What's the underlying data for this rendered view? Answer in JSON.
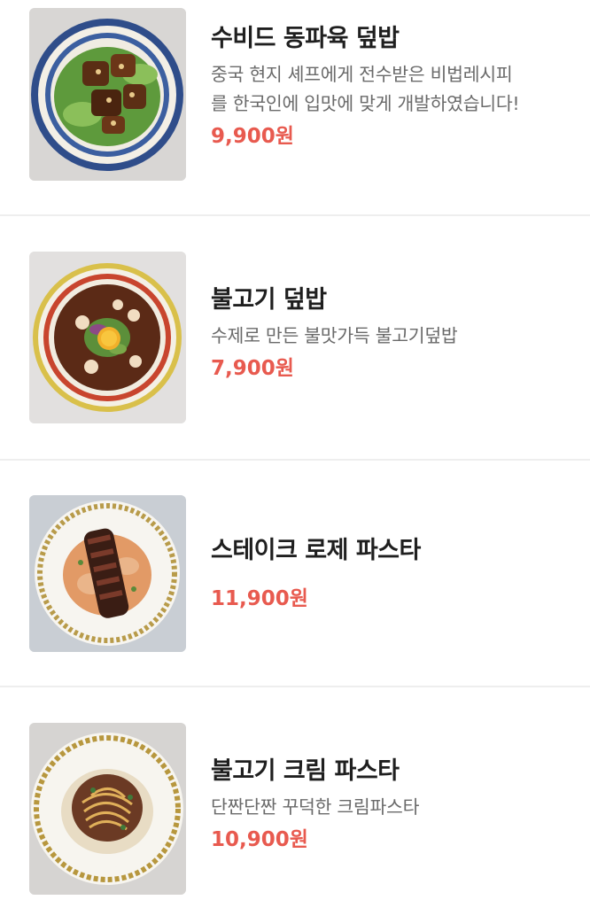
{
  "menu": {
    "items": [
      {
        "name": "수비드 동파육 덮밥",
        "description": "중국 현지 셰프에게 전수받은 비법레시피를 한국인에 입맛에 맞게 개발하였습니다!",
        "description_line1": "중국 현지 셰프에게 전수받은 비법레시피",
        "description_line2": "를 한국인에 입맛에 맞게 개발하였습니다!",
        "price": "9,900원"
      },
      {
        "name": "불고기 덮밥",
        "description_line1": "수제로 만든 불맛가득 불고기덮밥",
        "price": "7,900원"
      },
      {
        "name": "스테이크 로제 파스타",
        "price": "11,900원"
      },
      {
        "name": "불고기 크림 파스타",
        "description_line1": "단짠단짠 꾸덕한 크림파스타",
        "price": "10,900원"
      }
    ]
  },
  "colors": {
    "price": "#e85a4f",
    "title": "#1f1f1f",
    "description": "#6a6a6a",
    "divider": "#eeeeee"
  }
}
